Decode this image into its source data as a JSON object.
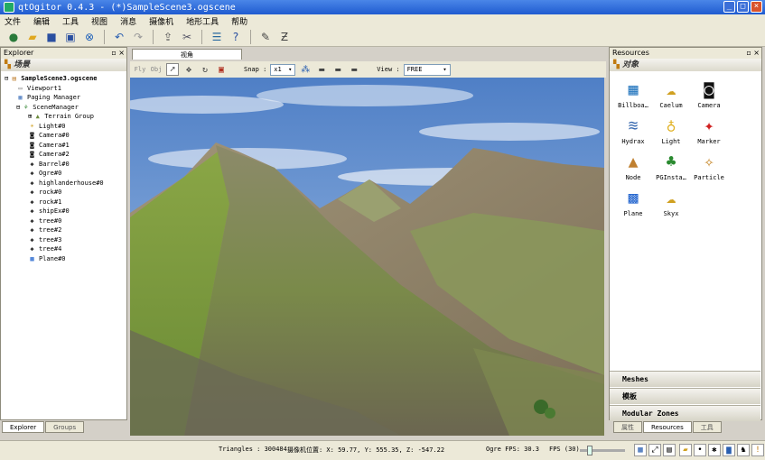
{
  "window": {
    "title": "qtOgitor 0.4.3 - (*)SampleScene3.ogscene"
  },
  "menu": [
    "文件",
    "编辑",
    "工具",
    "视图",
    "消息",
    "摄像机",
    "地形工具",
    "帮助"
  ],
  "explorer": {
    "title": "Explorer",
    "section": "场景",
    "tree": [
      {
        "label": "SampleScene3.ogscene",
        "depth": 0,
        "icon": "scene-icon",
        "bold": true
      },
      {
        "label": "Viewport1",
        "depth": 1,
        "icon": "viewport-icon"
      },
      {
        "label": "Paging Manager",
        "depth": 1,
        "icon": "paging-icon"
      },
      {
        "label": "SceneManager",
        "depth": 1,
        "icon": "scenemanager-icon"
      },
      {
        "label": "Terrain Group",
        "depth": 2,
        "icon": "terrain-icon"
      },
      {
        "label": "Light#0",
        "depth": 2,
        "icon": "light-icon"
      },
      {
        "label": "Camera#0",
        "depth": 2,
        "icon": "camera-icon"
      },
      {
        "label": "Camera#1",
        "depth": 2,
        "icon": "camera-icon"
      },
      {
        "label": "Camera#2",
        "depth": 2,
        "icon": "camera-icon"
      },
      {
        "label": "Barrel#0",
        "depth": 2,
        "icon": "entity-icon"
      },
      {
        "label": "Ogre#0",
        "depth": 2,
        "icon": "entity-icon"
      },
      {
        "label": "highlanderhouse#0",
        "depth": 2,
        "icon": "entity-icon"
      },
      {
        "label": "rock#0",
        "depth": 2,
        "icon": "entity-icon"
      },
      {
        "label": "rock#1",
        "depth": 2,
        "icon": "entity-icon"
      },
      {
        "label": "shipEx#0",
        "depth": 2,
        "icon": "entity-icon"
      },
      {
        "label": "tree#0",
        "depth": 2,
        "icon": "entity-icon"
      },
      {
        "label": "tree#2",
        "depth": 2,
        "icon": "entity-icon"
      },
      {
        "label": "tree#3",
        "depth": 2,
        "icon": "entity-icon"
      },
      {
        "label": "tree#4",
        "depth": 2,
        "icon": "entity-icon"
      },
      {
        "label": "Plane#0",
        "depth": 2,
        "icon": "plane-icon"
      }
    ],
    "tabs": [
      "Explorer",
      "Groups"
    ]
  },
  "viewport": {
    "tab_label": "视角",
    "fly_label": "Fly",
    "obj_label": "Obj",
    "snap_label": "Snap :",
    "snap_value": "x1",
    "view_label": "View :",
    "view_value": "FREE"
  },
  "resources": {
    "title": "Resources",
    "section": "对象",
    "items": [
      {
        "label": "Billboa…",
        "icon": "billboard-icon"
      },
      {
        "label": "Caelum",
        "icon": "cloud-icon"
      },
      {
        "label": "Camera",
        "icon": "camera-icon"
      },
      {
        "label": "Hydrax",
        "icon": "water-icon"
      },
      {
        "label": "Light",
        "icon": "lightbulb-icon"
      },
      {
        "label": "Marker",
        "icon": "pushpin-icon"
      },
      {
        "label": "Node",
        "icon": "node-icon"
      },
      {
        "label": "PGInsta…",
        "icon": "palm-tree-icon"
      },
      {
        "label": "Particle",
        "icon": "magic-wand-icon"
      },
      {
        "label": "Plane",
        "icon": "grid-plane-icon"
      },
      {
        "label": "Skyx",
        "icon": "cloud-icon"
      }
    ],
    "accordion": [
      "Meshes",
      "模板",
      "Modular Zones"
    ],
    "tabs": [
      "属性",
      "Resources",
      "工具"
    ]
  },
  "status": {
    "triangles": "Triangles : 300484",
    "camera_pos": "摄像机位置: X:  59.77, Y:  555.35, Z: -547.22",
    "ogre_fps": "Ogre FPS: 30.3",
    "fps": "FPS (30)"
  },
  "colors": {
    "title_bar": "#1f5bd0",
    "chrome": "#ece9d8",
    "sky": "#5a89c8"
  }
}
